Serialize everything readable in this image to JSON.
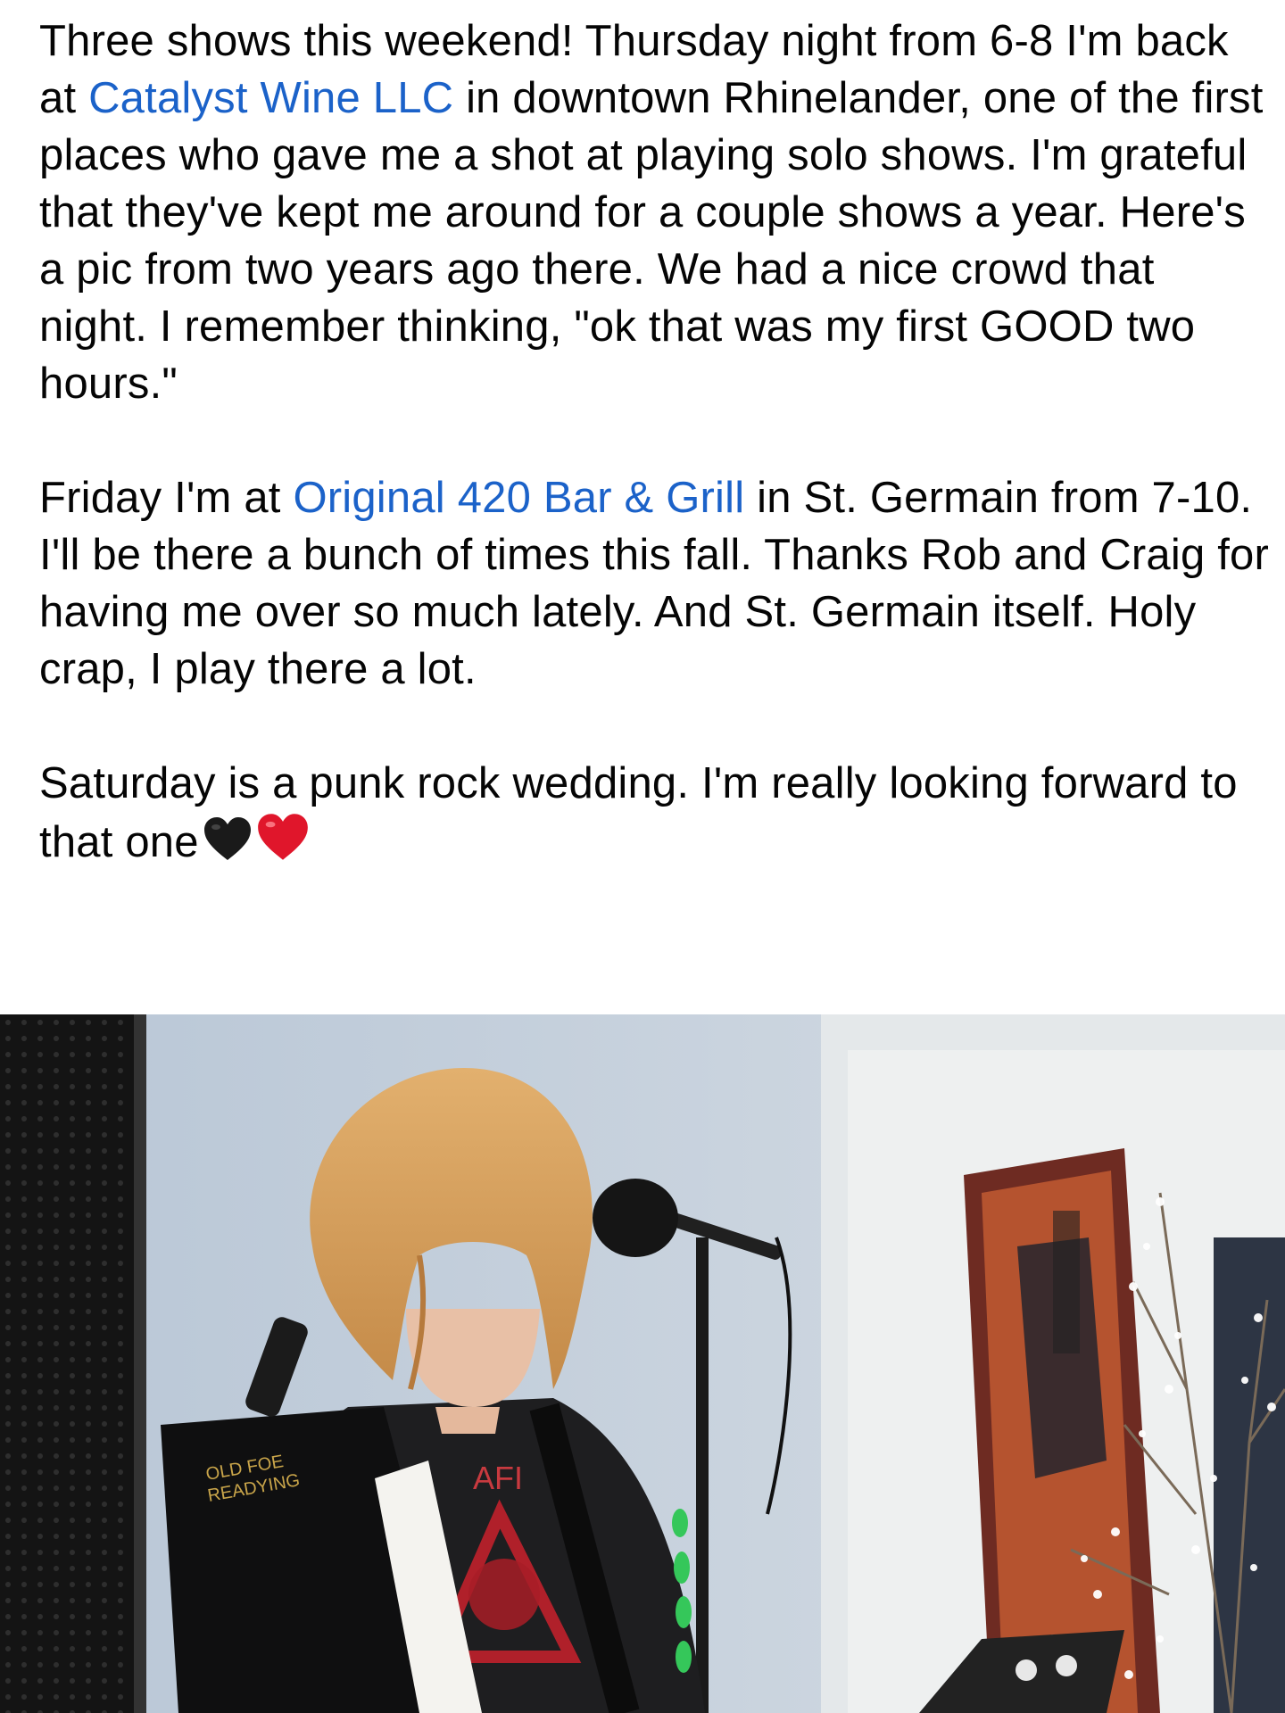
{
  "post": {
    "p1": {
      "a": "Three shows this weekend! Thursday night from 6-8 I'm back at ",
      "link": "Catalyst Wine LLC",
      "b": " in downtown Rhinelander, one of the first places who gave me a shot at playing solo shows. I'm grateful that they've kept me around for a couple shows a year. Here's a pic from two years ago there. We had a nice crowd that night. I remember thinking, \"ok that was my first GOOD two hours.\""
    },
    "p2": {
      "a": "Friday I'm at ",
      "link": "Original 420 Bar & Grill",
      "b": " in St. Germain from 7-10. I'll be there a bunch of times this fall. Thanks Rob and Craig for having me over so much lately. And St. Germain itself. Holy crap, I play there a lot."
    },
    "p3": {
      "a": "Saturday is a punk rock wedding. I'm really looking forward to that one"
    },
    "emoji": [
      "black-heart-icon",
      "red-heart-icon"
    ]
  },
  "photo": {
    "shirt_text": "AFI",
    "sticker_text_1": "OLD FOE",
    "sticker_text_2": "READYING"
  },
  "colors": {
    "link": "#1b62c9",
    "text": "#050505",
    "background": "#ffffff"
  }
}
